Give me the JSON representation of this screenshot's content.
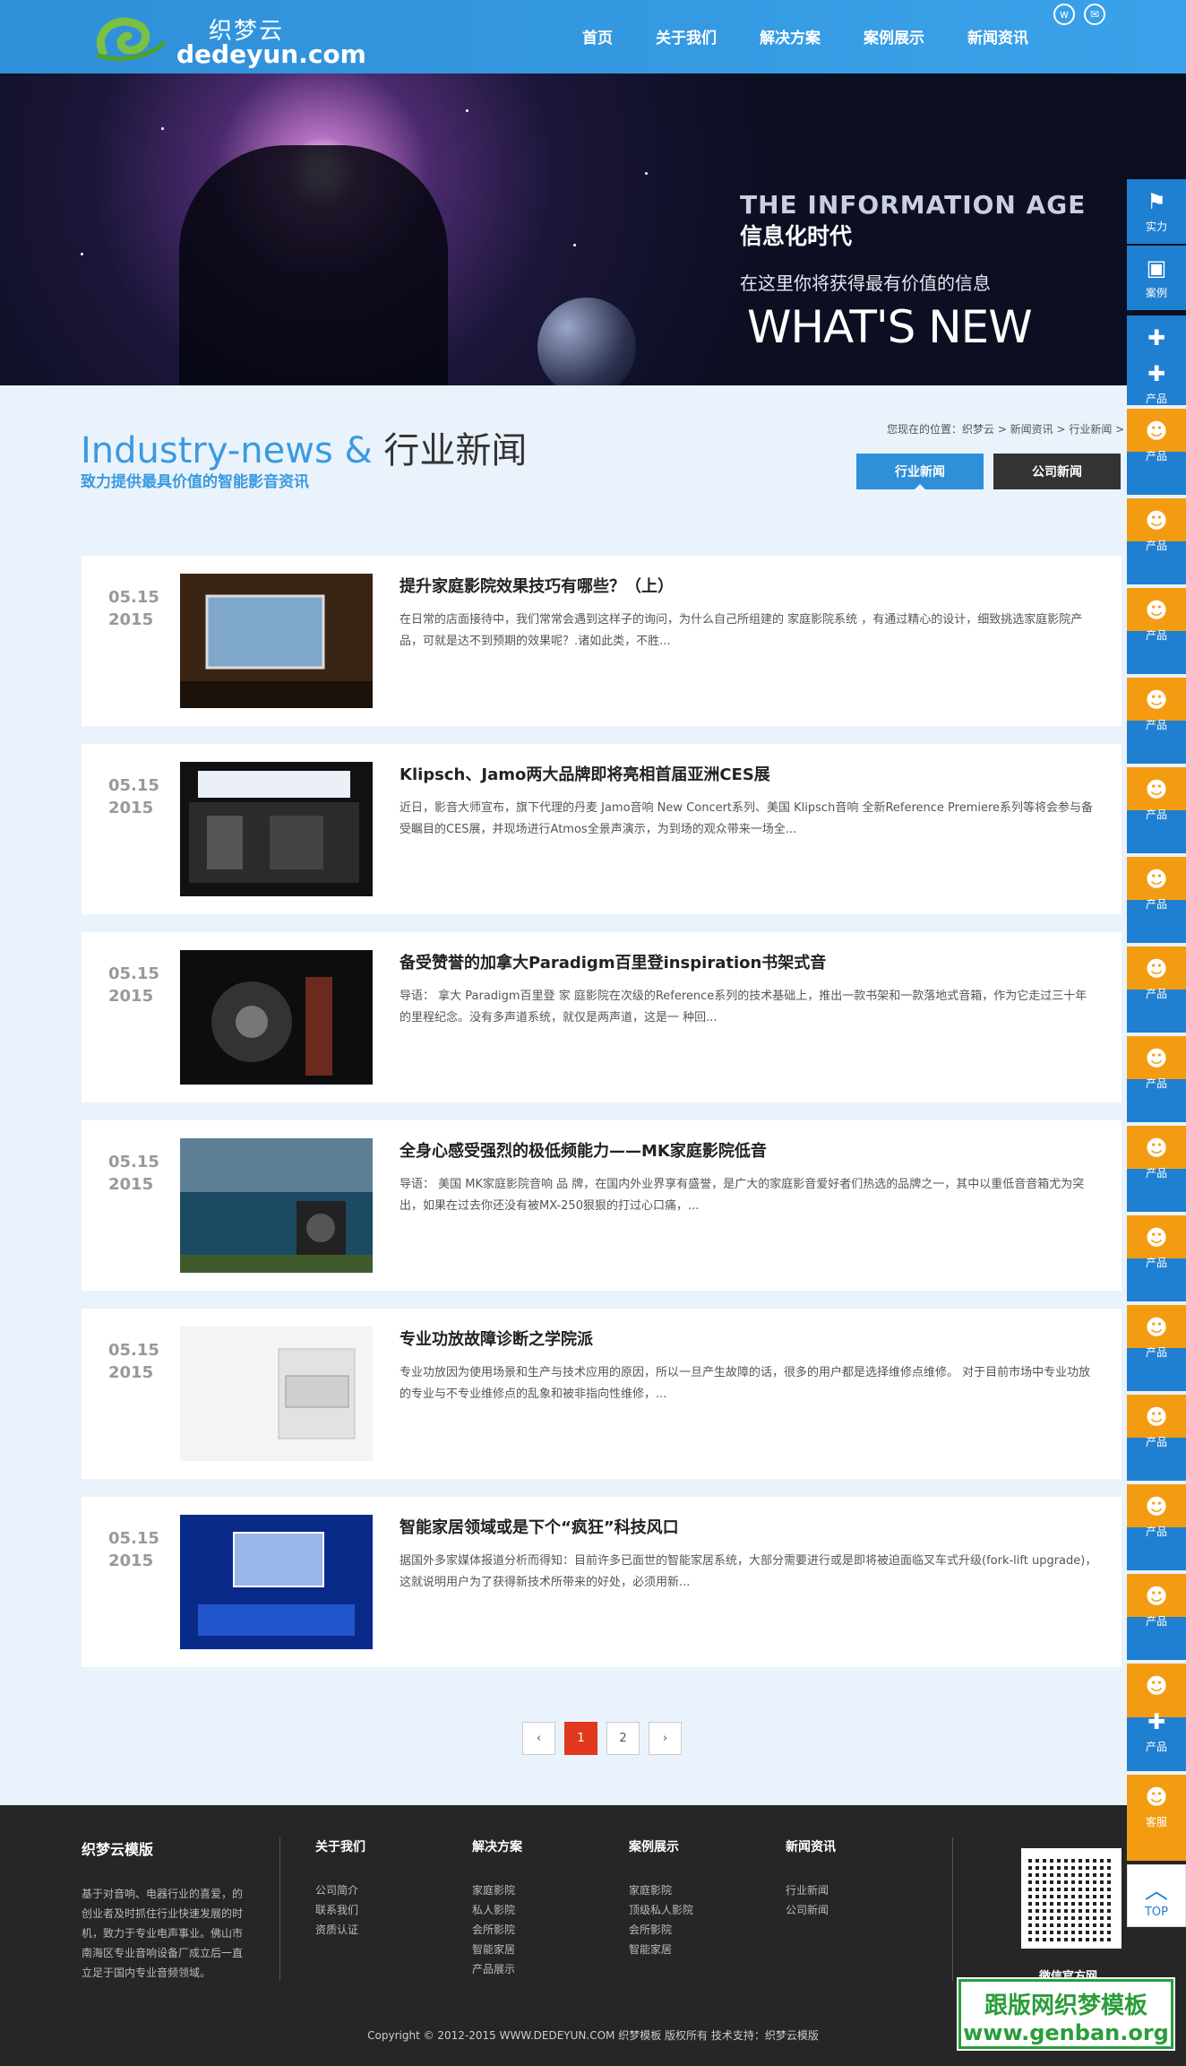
{
  "header": {
    "logo_cn": "织梦云",
    "logo_en": "dedeyun.com",
    "nav": [
      "首页",
      "关于我们",
      "解决方案",
      "案例展示",
      "新闻资讯"
    ],
    "icons": [
      "weibo-icon",
      "wechat-icon"
    ]
  },
  "banner": {
    "line1": "THE INFORMATION AGE",
    "line2": "信息化时代",
    "line3": "在这里你将获得最有价值的信息",
    "line4": "WHAT'S NEW"
  },
  "section": {
    "title_en": "Industry-news &",
    "title_cn": "行业新闻",
    "subtitle": "致力提供最具价值的智能影音资讯",
    "breadcrumb": "您现在的位置：织梦云 > 新闻资讯 > 行业新闻 >",
    "tabs": [
      "行业新闻",
      "公司新闻"
    ]
  },
  "news": [
    {
      "date": "05.15",
      "year": "2015",
      "title": "提升家庭影院效果技巧有哪些？（上）",
      "desc": "在日常的店面接待中，我们常常会遇到这样子的询问，为什么自己所组建的 家庭影院系统 ，有通过精心的设计，细致挑选家庭影院产品，可就是达不到预期的效果呢？.诸如此类，不胜..."
    },
    {
      "date": "05.15",
      "year": "2015",
      "title": "Klipsch、Jamo两大品牌即将亮相首届亚洲CES展",
      "desc": "近日，影音大师宣布，旗下代理的丹麦 Jamo音响 New Concert系列、美国 Klipsch音响 全新Reference Premiere系列等将会参与备受瞩目的CES展，并现场进行Atmos全景声演示，为到场的观众带来一场全..."
    },
    {
      "date": "05.15",
      "year": "2015",
      "title": "备受赞誉的加拿大Paradigm百里登inspiration书架式音",
      "desc": "导语： 拿大 Paradigm百里登 家 庭影院在次级的Reference系列的技术基础上，推出一款书架和一款落地式音箱，作为它走过三十年的里程纪念。没有多声道系统，就仅是两声道，这是一 种回..."
    },
    {
      "date": "05.15",
      "year": "2015",
      "title": "全身心感受强烈的极低频能力——MK家庭影院低音",
      "desc": "导语： 美国 MK家庭影院音响 品 牌，在国内外业界享有盛誉，是广大的家庭影音爱好者们热选的品牌之一，其中以重低音音箱尤为突出，如果在过去你还没有被MX-250狠狠的打过心口痛，..."
    },
    {
      "date": "05.15",
      "year": "2015",
      "title": "专业功放故障诊断之学院派",
      "desc": "专业功放因为使用场景和生产与技术应用的原因，所以一旦产生故障的话，很多的用户都是选择维修点维修。 对于目前市场中专业功放的专业与不专业维修点的乱象和被非指向性维修，..."
    },
    {
      "date": "05.15",
      "year": "2015",
      "title": "智能家居领域或是下个“疯狂”科技风口",
      "desc": "据国外多家媒体报道分析而得知：目前许多已面世的智能家居系统，大部分需要进行或是即将被迫面临叉车式升级(fork-lift upgrade)，这就说明用户为了获得新技术所带来的好处，必须用新..."
    }
  ],
  "pager": {
    "prev": "‹",
    "pages": [
      "1",
      "2"
    ],
    "next": "›"
  },
  "footer": {
    "brand": "织梦云模版",
    "intro": "基于对音响、电器行业的喜爱，的创业者及时抓住行业快速发展的时机，致力于专业电声事业。佛山市南海区专业音响设备厂成立后一直立足于国内专业音频领域。",
    "cols": [
      {
        "title": "关于我们",
        "items": [
          "公司简介",
          "联系我们",
          "资质认证"
        ]
      },
      {
        "title": "解决方案",
        "items": [
          "家庭影院",
          "私人影院",
          "会所影院",
          "智能家居",
          "产品展示"
        ]
      },
      {
        "title": "案例展示",
        "items": [
          "家庭影院",
          "顶级私人影院",
          "会所影院",
          "智能家居"
        ]
      },
      {
        "title": "新闻资讯",
        "items": [
          "行业新闻",
          "公司新闻"
        ]
      }
    ],
    "qr_label": "微信官方网",
    "copyright": "Copyright © 2012-2015 WWW.DEDEYUN.COM 织梦模板 版权所有 技术支持：织梦云模版",
    "watermark1": "跟版网织梦模板",
    "watermark2": "www.genban.org"
  },
  "sidebar": {
    "items": [
      "实力",
      "案例",
      "产品",
      "产品",
      "产品",
      "产品",
      "产品",
      "产品",
      "产品",
      "产品",
      "产品",
      "产品",
      "产品",
      "产品",
      "产品",
      "产品",
      "产品",
      "产品",
      "客服"
    ],
    "top": "TOP",
    "colors": {
      "blue": "#1f7fd0",
      "orange": "#f39c12"
    }
  }
}
